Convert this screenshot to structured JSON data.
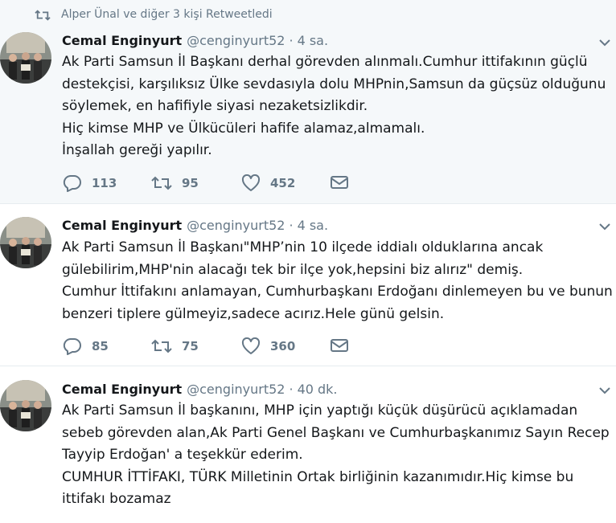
{
  "retweet_context": {
    "text": "Alper Ünal ve diğer 3 kişi Retweetledi",
    "icon": "retweet-icon"
  },
  "colors": {
    "secondary_text": "#657786",
    "highlight_bg": "#f5f8fa",
    "divider": "#e6ecf0"
  },
  "tweets": [
    {
      "name": "Cemal Enginyurt",
      "handle": "@cenginyurt52",
      "sep": "·",
      "time": "4 sa.",
      "lines": [
        "Ak Parti Samsun İl Başkanı derhal görevden alınmalı.Cumhur ittifakının güçlü",
        "destekçisi, karşılıksız Ülke sevdasıyla dolu MHPnin,Samsun da güçsüz olduğunu",
        "söylemek, en hafifiyle siyasi nezaketsizlikdir.",
        "Hiç kimse MHP ve Ülkücüleri hafife alamaz,almamalı.",
        "İnşallah gereği yapılır."
      ],
      "replies": "113",
      "retweets": "95",
      "likes": "452"
    },
    {
      "name": "Cemal Enginyurt",
      "handle": "@cenginyurt52",
      "sep": "·",
      "time": "4 sa.",
      "lines": [
        "Ak Parti Samsun İl Başkanı\"MHP’nin 10 ilçede iddialı olduklarına ancak",
        "gülebilirim,MHP'nin alacağı tek bir ilçe yok,hepsini biz alırız\" demiş.",
        "Cumhur İttifakını anlamayan,  Cumhurbaşkanı Erdoğanı dinlemeyen bu ve bunun",
        "benzeri tiplere gülmeyiz,sadece acırız.Hele günü gelsin."
      ],
      "replies": "85",
      "retweets": "75",
      "likes": "360"
    },
    {
      "name": "Cemal Enginyurt",
      "handle": "@cenginyurt52",
      "sep": "·",
      "time": "40 dk.",
      "lines": [
        "Ak Parti  Samsun İl başkanını, MHP için yaptığı küçük düşürücü açıklamadan",
        "sebeb görevden alan,Ak Parti Genel Başkanı ve Cumhurbaşkanımız Sayın Recep",
        "Tayyip Erdoğan' a teşekkür ederim.",
        "CUMHUR İTTİFAKI, TÜRK Milletinin Ortak birliğinin kazanımıdır.Hiç kimse bu",
        "ittifakı bozamaz"
      ]
    }
  ]
}
